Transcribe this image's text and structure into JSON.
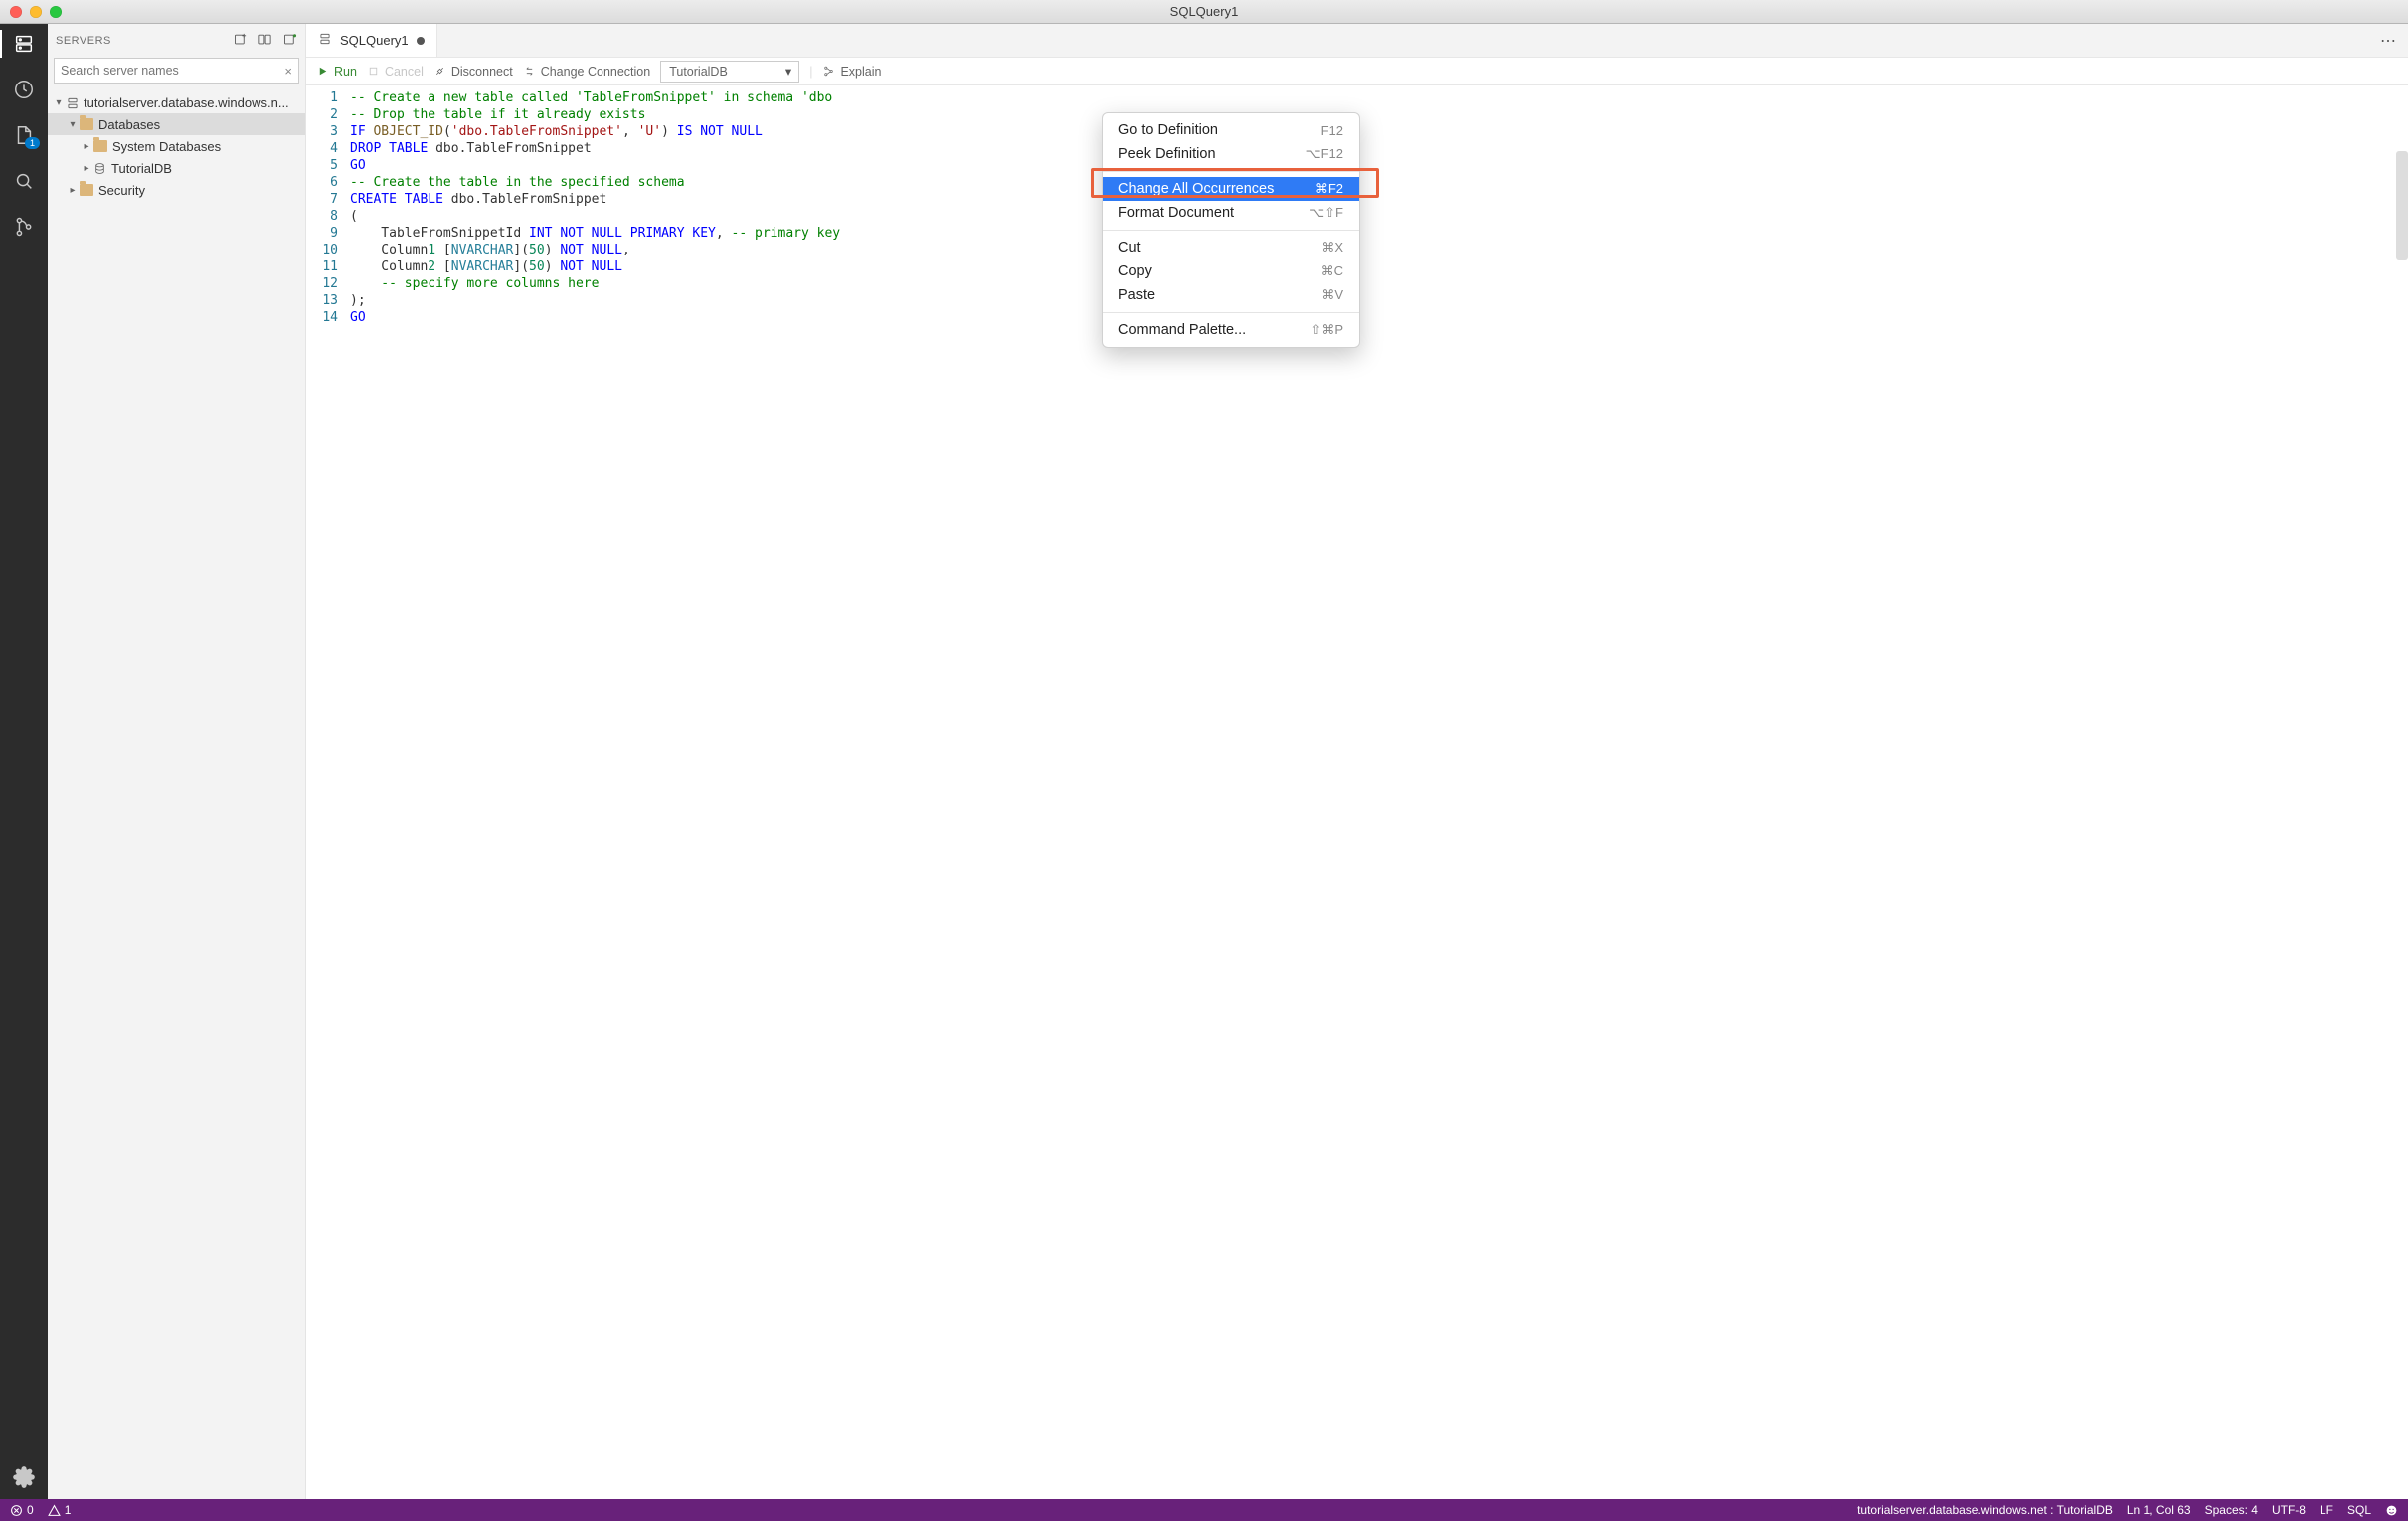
{
  "window": {
    "title": "SQLQuery1"
  },
  "sidebar": {
    "title": "SERVERS",
    "search_placeholder": "Search server names",
    "tree": {
      "server": "tutorialserver.database.windows.n...",
      "databases": "Databases",
      "system_databases": "System Databases",
      "tutorialdb": "TutorialDB",
      "security": "Security"
    }
  },
  "tab": {
    "label": "SQLQuery1"
  },
  "toolbar": {
    "run": "Run",
    "cancel": "Cancel",
    "disconnect": "Disconnect",
    "change_conn": "Change Connection",
    "db_selected": "TutorialDB",
    "explain": "Explain"
  },
  "code_lines": [
    "-- Create a new table called 'TableFromSnippet' in schema 'dbo",
    "-- Drop the table if it already exists",
    "IF OBJECT_ID('dbo.TableFromSnippet', 'U') IS NOT NULL",
    "DROP TABLE dbo.TableFromSnippet",
    "GO",
    "-- Create the table in the specified schema",
    "CREATE TABLE dbo.TableFromSnippet",
    "(",
    "    TableFromSnippetId INT NOT NULL PRIMARY KEY, -- primary key",
    "    Column1 [NVARCHAR](50) NOT NULL,",
    "    Column2 [NVARCHAR](50) NOT NULL",
    "    -- specify more columns here",
    ");",
    "GO"
  ],
  "context_menu": [
    {
      "label": "Go to Definition",
      "shortcut": "F12"
    },
    {
      "label": "Peek Definition",
      "shortcut": "⌥F12"
    },
    {
      "sep": true
    },
    {
      "label": "Change All Occurrences",
      "shortcut": "⌘F2",
      "selected": true
    },
    {
      "label": "Format Document",
      "shortcut": "⌥⇧F"
    },
    {
      "sep": true
    },
    {
      "label": "Cut",
      "shortcut": "⌘X"
    },
    {
      "label": "Copy",
      "shortcut": "⌘C"
    },
    {
      "label": "Paste",
      "shortcut": "⌘V"
    },
    {
      "sep": true
    },
    {
      "label": "Command Palette...",
      "shortcut": "⇧⌘P"
    }
  ],
  "statusbar": {
    "errors": "0",
    "warnings": "1",
    "connection": "tutorialserver.database.windows.net : TutorialDB",
    "position": "Ln 1, Col 63",
    "spaces": "Spaces: 4",
    "encoding": "UTF-8",
    "eol": "LF",
    "lang": "SQL"
  }
}
